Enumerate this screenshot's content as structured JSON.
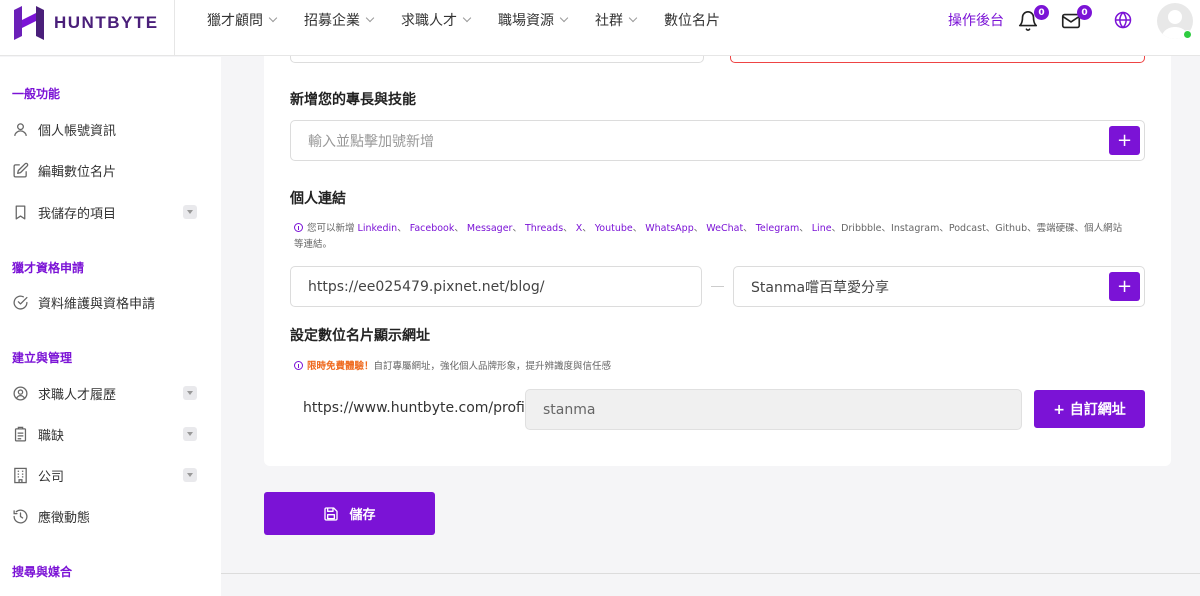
{
  "brand": {
    "name": "HUNTBYTE",
    "color": "#7b13d6"
  },
  "nav": {
    "items": [
      {
        "label": "獵才顧問",
        "dropdown": true
      },
      {
        "label": "招募企業",
        "dropdown": true
      },
      {
        "label": "求職人才",
        "dropdown": true
      },
      {
        "label": "職場資源",
        "dropdown": true
      },
      {
        "label": "社群",
        "dropdown": true
      },
      {
        "label": "數位名片",
        "dropdown": false
      }
    ],
    "dashboard_label": "操作後台",
    "notification_count": "0",
    "message_count": "0"
  },
  "sidebar": {
    "groups": {
      "general": "一般功能",
      "qualification": "獵才資格申請",
      "manage": "建立與管理",
      "search": "搜尋與媒合"
    },
    "items": {
      "account": "個人帳號資訊",
      "edit_card": "編輯數位名片",
      "saved": "我儲存的項目",
      "qualify": "資料維護與資格申請",
      "resume": "求職人才履歷",
      "jobs": "職缺",
      "company": "公司",
      "activity": "應徵動態"
    }
  },
  "skills": {
    "title": "新增您的專長與技能",
    "placeholder": "輸入並點擊加號新增",
    "add_label": "+"
  },
  "links": {
    "title": "個人連結",
    "hint_prefix": "您可以新增",
    "hint_links": [
      "Linkedin",
      "Facebook",
      "Messager",
      "Threads",
      "X",
      "Youtube",
      "WhatsApp",
      "WeChat",
      "Telegram",
      "Line"
    ],
    "hint_rest": "、Dribbble、Instagram、Podcast、Github、雲端硬碟、個人網站",
    "hint_tail": "等連結。",
    "url_value": "https://ee025479.pixnet.net/blog/",
    "name_value": "Stanma嚐百草愛分享",
    "add_label": "+"
  },
  "card_url": {
    "title": "設定數位名片顯示網址",
    "promo": "限時免費體驗！",
    "hint": "自訂專屬網址，強化個人品牌形象，提升辨識度與信任感",
    "prefix": "https://www.huntbyte.com/profile/",
    "slug": "stanma",
    "button_label": "+ 自訂網址"
  },
  "save_label": "儲存"
}
